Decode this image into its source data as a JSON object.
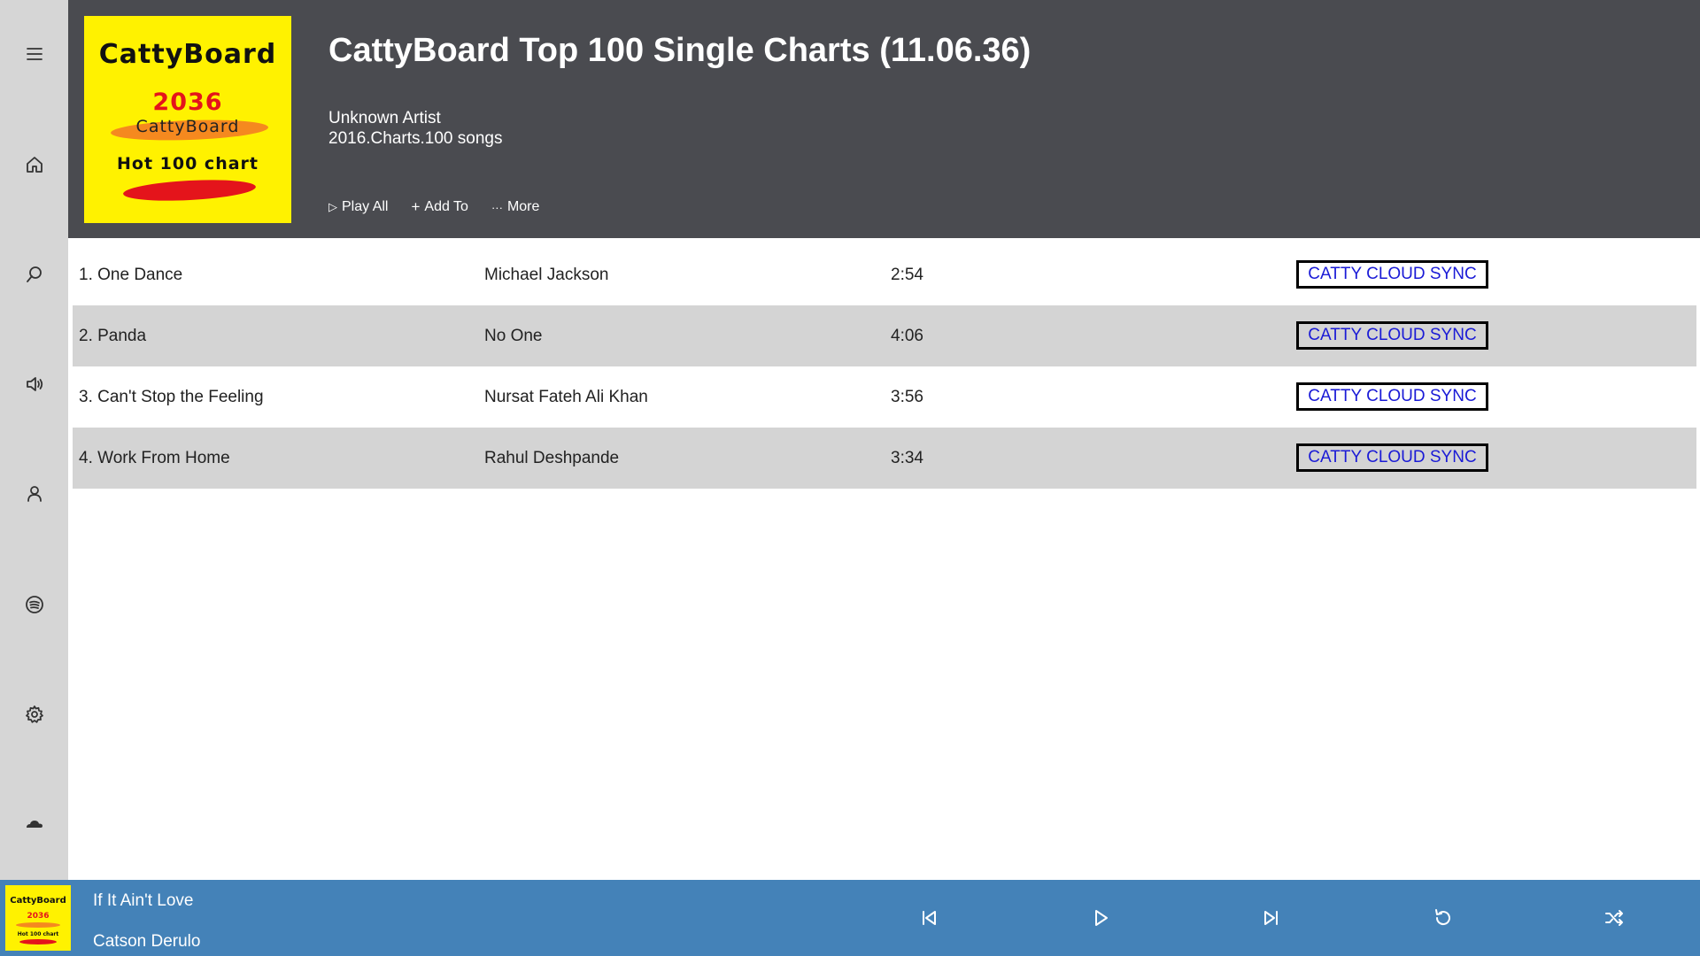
{
  "sidebar": {
    "icons": [
      "menu-icon",
      "home-icon",
      "search-icon",
      "volume-icon",
      "user-icon",
      "spotify-icon",
      "gear-icon",
      "cloud-icon"
    ]
  },
  "header": {
    "cover": {
      "title": "CattyBoard",
      "year": "2036",
      "subtitle": "CattyBoard",
      "chart": "Hot 100 chart"
    },
    "title": "CattyBoard Top 100 Single Charts (11.06.36)",
    "artist": "Unknown Artist",
    "meta": "2016.Charts.100 songs",
    "actions": {
      "play_all": "Play All",
      "add_to": "Add To",
      "more": "More"
    }
  },
  "tracks": [
    {
      "title": "1. One Dance",
      "artist": "Michael Jackson",
      "duration": "2:54",
      "sync": "CATTY CLOUD SYNC"
    },
    {
      "title": "2. Panda",
      "artist": "No One",
      "duration": "4:06",
      "sync": "CATTY CLOUD SYNC"
    },
    {
      "title": "3. Can't Stop the Feeling",
      "artist": "Nursat Fateh Ali Khan",
      "duration": "3:56",
      "sync": "CATTY CLOUD SYNC"
    },
    {
      "title": "4. Work From Home",
      "artist": "Rahul Deshpande",
      "duration": "3:34",
      "sync": "CATTY CLOUD SYNC"
    }
  ],
  "player": {
    "cover": {
      "title": "CattyBoard",
      "year": "2036",
      "subtitle": "CattyBoard",
      "chart": "Hot 100 chart"
    },
    "now_title": "If It Ain't Love",
    "now_artist": "Catson Derulo",
    "controls": [
      "previous-icon",
      "play-icon",
      "next-icon",
      "repeat-icon",
      "shuffle-icon"
    ]
  },
  "colors": {
    "sidebar": "#d6d6d6",
    "header": "#4a4b50",
    "player": "#4482b8",
    "row_alt": "#d4d4d4",
    "cover": "#fff200",
    "sync_text": "#1a1ad6"
  }
}
